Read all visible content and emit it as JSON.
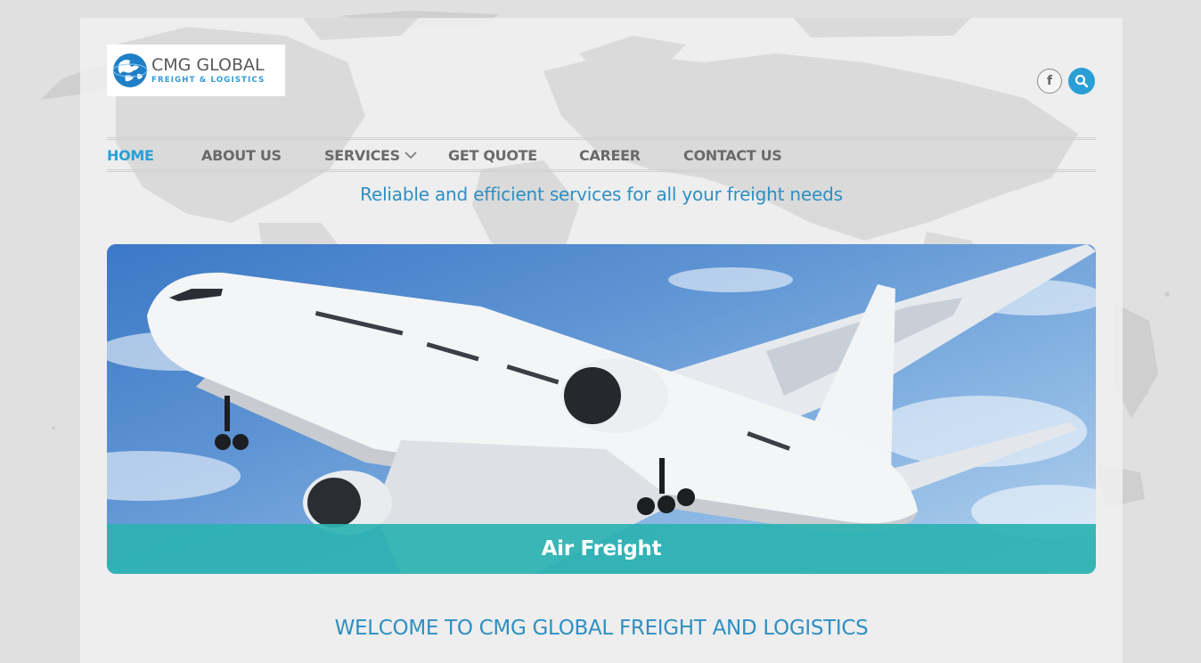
{
  "brand": {
    "name": "CMG GLOBAL",
    "subtitle": "FREIGHT & LOGISTICS"
  },
  "header": {
    "social": [
      {
        "icon": "facebook-icon",
        "glyph": "f"
      },
      {
        "icon": "search-icon"
      }
    ]
  },
  "nav": {
    "items": [
      {
        "label": "HOME",
        "active": true
      },
      {
        "label": "ABOUT US",
        "active": false
      },
      {
        "label": "SERVICES",
        "active": false,
        "has_dropdown": true
      },
      {
        "label": "GET QUOTE",
        "active": false
      },
      {
        "label": "CAREER",
        "active": false
      },
      {
        "label": "CONTACT US",
        "active": false
      }
    ]
  },
  "tagline": "Reliable and efficient services for all your freight needs",
  "slider": {
    "caption": "Air Freight"
  },
  "welcome": {
    "heading": "WELCOME TO CMG GLOBAL FREIGHT AND LOGISTICS"
  },
  "colors": {
    "accent": "#2a9fd6",
    "caption_bar": "#2bb2b2",
    "nav_text": "#6a6a6a",
    "page_bg": "#e0e0e0"
  }
}
